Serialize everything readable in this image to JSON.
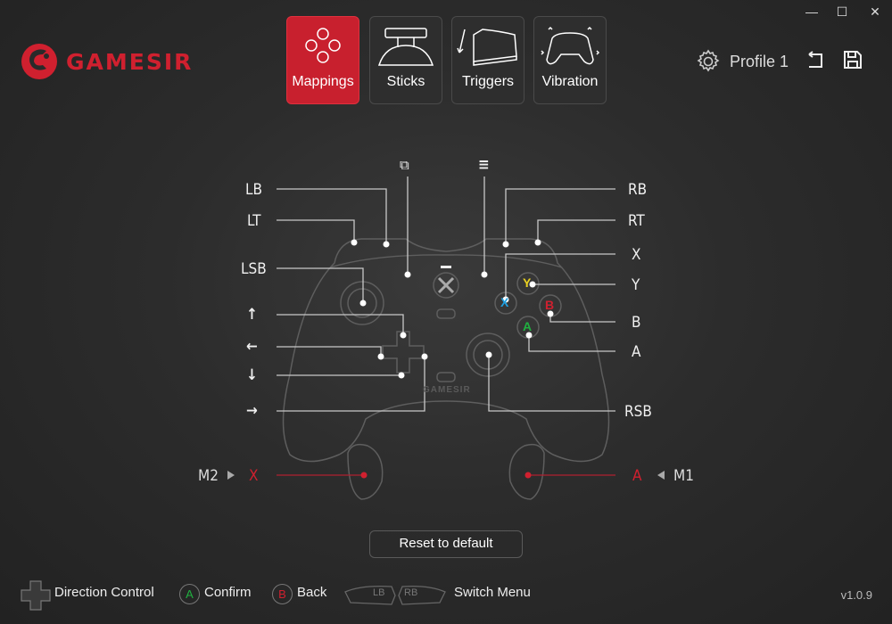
{
  "window": {
    "minimize": "—",
    "maximize": "☐",
    "close": "✕"
  },
  "brand": {
    "name": "GAMESIR",
    "color": "#d0202f"
  },
  "tabs": [
    {
      "label": "Mappings",
      "icon": "face-buttons-icon",
      "active": true
    },
    {
      "label": "Sticks",
      "icon": "joystick-icon",
      "active": false
    },
    {
      "label": "Triggers",
      "icon": "trigger-icon",
      "active": false
    },
    {
      "label": "Vibration",
      "icon": "vibration-controller-icon",
      "active": false
    }
  ],
  "profile": {
    "label": "Profile 1"
  },
  "mappings": {
    "left": {
      "lb": "LB",
      "lt": "LT",
      "lsb": "LSB",
      "up": "↑",
      "left": "←",
      "down": "↓",
      "right": "→"
    },
    "right": {
      "rb": "RB",
      "rt": "RT",
      "x": "X",
      "y": "Y",
      "b": "B",
      "a": "A",
      "rsb": "RSB"
    },
    "top": {
      "view": "⧉",
      "menu": "≡"
    },
    "m2": {
      "label": "M2",
      "value": "X"
    },
    "m1": {
      "label": "M1",
      "value": "A"
    }
  },
  "face_buttons": {
    "y": "Y",
    "x": "X",
    "b": "B",
    "a": "A",
    "colors": {
      "y": "#e8d020",
      "x": "#20a0e0",
      "b": "#d0202f",
      "a": "#20b040"
    }
  },
  "controller_brand": "GAMESIR",
  "reset_label": "Reset to default",
  "hints": {
    "direction": "Direction Control",
    "confirm_key": "A",
    "confirm": "Confirm",
    "back_key": "B",
    "back": "Back",
    "lb": "LB",
    "rb": "RB",
    "switch": "Switch Menu"
  },
  "version": "v1.0.9",
  "accent": "#c8202e"
}
